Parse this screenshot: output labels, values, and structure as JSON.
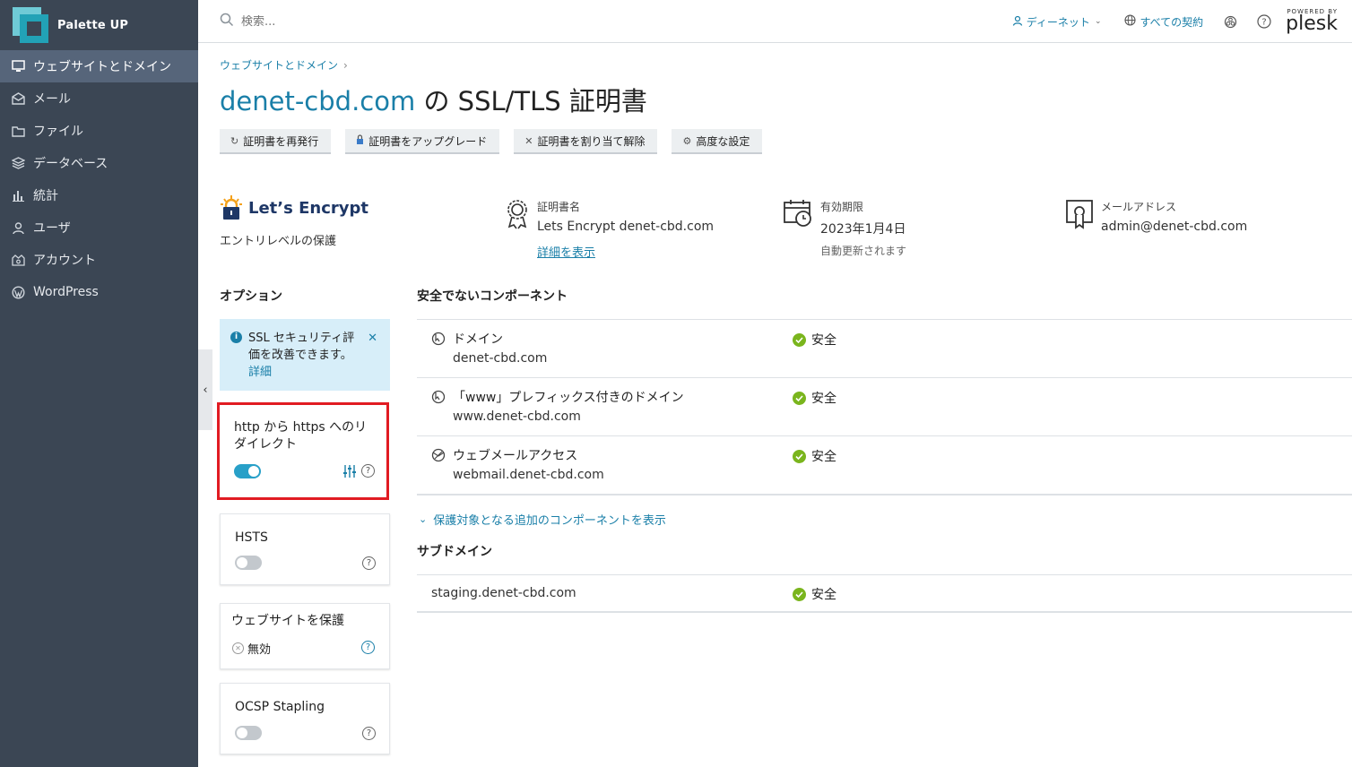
{
  "brand": {
    "name": "Palette UP"
  },
  "sidebar": {
    "items": [
      {
        "label": "ウェブサイトとドメイン",
        "icon": "monitor-icon",
        "active": true
      },
      {
        "label": "メール",
        "icon": "mail-icon"
      },
      {
        "label": "ファイル",
        "icon": "folder-icon"
      },
      {
        "label": "データベース",
        "icon": "database-icon"
      },
      {
        "label": "統計",
        "icon": "bar-chart-icon"
      },
      {
        "label": "ユーザ",
        "icon": "user-icon"
      },
      {
        "label": "アカウント",
        "icon": "account-icon"
      },
      {
        "label": "WordPress",
        "icon": "wordpress-icon"
      }
    ]
  },
  "topbar": {
    "search_placeholder": "検索...",
    "user_label": "ディーネット",
    "subscriptions_label": "すべての契約",
    "powered_by": "POWERED BY",
    "plesk": "plesk"
  },
  "breadcrumb": {
    "item": "ウェブサイトとドメイン",
    "sep": "›"
  },
  "title": {
    "domain": "denet-cbd.com",
    "rest": " の SSL/TLS 証明書"
  },
  "toolbar": {
    "reissue": "証明書を再発行",
    "upgrade": "証明書をアップグレード",
    "unassign": "証明書を割り当て解除",
    "advanced": "高度な設定"
  },
  "certificate": {
    "issuer": "Let’s Encrypt",
    "level": "エントリレベルの保護",
    "name_label": "証明書名",
    "name_value": "Lets Encrypt denet-cbd.com",
    "details_link": "詳細を表示",
    "expiry_label": "有効期限",
    "expiry_value": "2023年1月4日",
    "expiry_note": "自動更新されます",
    "email_label": "メールアドレス",
    "email_value": "admin@denet-cbd.com"
  },
  "options": {
    "heading": "オプション",
    "notice_text": "SSL セキュリティ評価を改善できます。",
    "notice_link": "詳細",
    "redirect_title": "http から https へのリダイレクト",
    "redirect_on": true,
    "hsts_title": "HSTS",
    "hsts_on": false,
    "protect_title": "ウェブサイトを保護",
    "protect_status": "無効",
    "ocsp_title": "OCSP Stapling",
    "ocsp_on": false
  },
  "insecure": {
    "heading": "安全でないコンポーネント",
    "rows": [
      {
        "name": "ドメイン",
        "host": "denet-cbd.com",
        "status": "安全",
        "icon": "globe-cursor-icon"
      },
      {
        "name": "「www」プレフィックス付きのドメイン",
        "host": "www.denet-cbd.com",
        "status": "安全",
        "icon": "globe-cursor-icon"
      },
      {
        "name": "ウェブメールアクセス",
        "host": "webmail.denet-cbd.com",
        "status": "安全",
        "icon": "webmail-globe-icon"
      }
    ],
    "more_link": "保護対象となる追加のコンポーネントを表示"
  },
  "subdomains": {
    "heading": "サブドメイン",
    "rows": [
      {
        "host": "staging.denet-cbd.com",
        "status": "安全"
      }
    ]
  },
  "colors": {
    "sidebar_bg": "#3b4654",
    "accent": "#1a7fa8",
    "ok_green": "#7ab51d",
    "highlight_red": "#e11b22"
  }
}
